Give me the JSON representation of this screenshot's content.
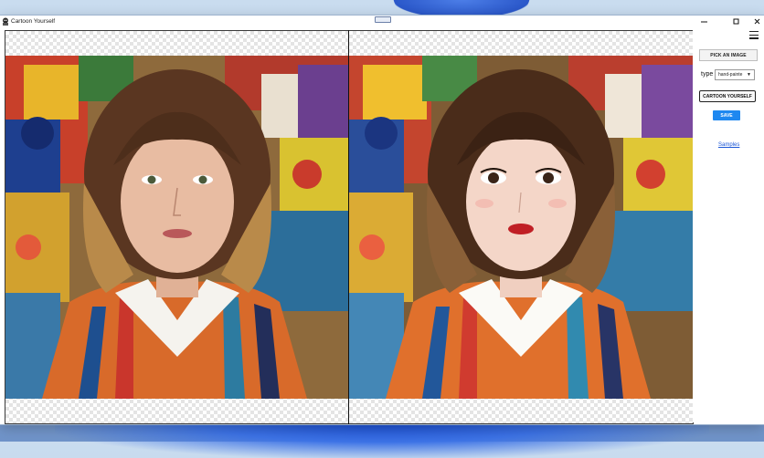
{
  "window": {
    "title": "Cartoon Yourself"
  },
  "sidebar": {
    "pick_button": "PICK AN IMAGE",
    "type_label": "type",
    "type_value": "hand-painte",
    "cartoon_button": "CARTOON YOURSELF",
    "save_button": "SAVE",
    "samples_link": "Samples"
  },
  "colors": {
    "accent": "#1e88f0",
    "link": "#1a56d6"
  }
}
